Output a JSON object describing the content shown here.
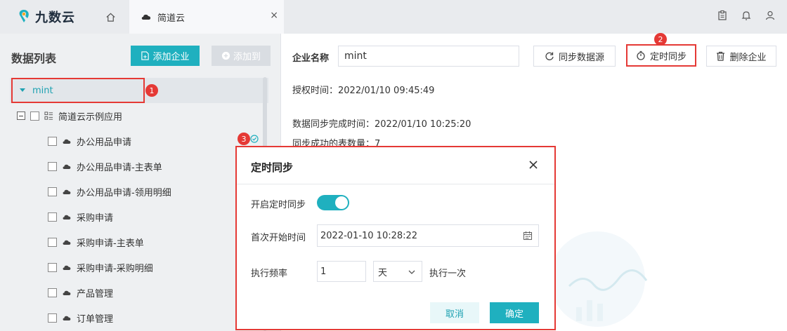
{
  "topbar": {
    "logo_text": "九数云",
    "active_tab": "简道云",
    "close_glyph": "×",
    "icons": [
      "clipboard-icon",
      "bell-icon",
      "user-icon"
    ]
  },
  "left": {
    "title": "数据列表",
    "add_enterprise": "添加企业",
    "add_to": "添加到",
    "root": "mint",
    "app_group": "简道云示例应用",
    "items": [
      "办公用品申请",
      "办公用品申请-主表单",
      "办公用品申请-领用明细",
      "采购申请",
      "采购申请-主表单",
      "采购申请-采购明细",
      "产品管理",
      "订单管理"
    ]
  },
  "content": {
    "ent_label": "企业名称",
    "ent_value": "mint",
    "btn_sync": "同步数据源",
    "btn_schedule": "定时同步",
    "btn_delete": "删除企业",
    "auth_time": "授权时间：2022/01/10 09:45:49",
    "sync_done": "数据同步完成时间：2022/01/10 10:25:20",
    "sync_count": "同步成功的表数量：7"
  },
  "badges": [
    "1",
    "2",
    "3"
  ],
  "dialog": {
    "title": "定时同步",
    "enable_label": "开启定时同步",
    "enabled": true,
    "start_label": "首次开始时间",
    "start_value": "2022-01-10 10:28:22",
    "freq_label": "执行频率",
    "freq_value": "1",
    "freq_unit": "天",
    "freq_suffix": "执行一次",
    "cancel": "取消",
    "ok": "确定"
  },
  "colors": {
    "accent": "#1fb0bf",
    "highlight": "#e53935"
  }
}
